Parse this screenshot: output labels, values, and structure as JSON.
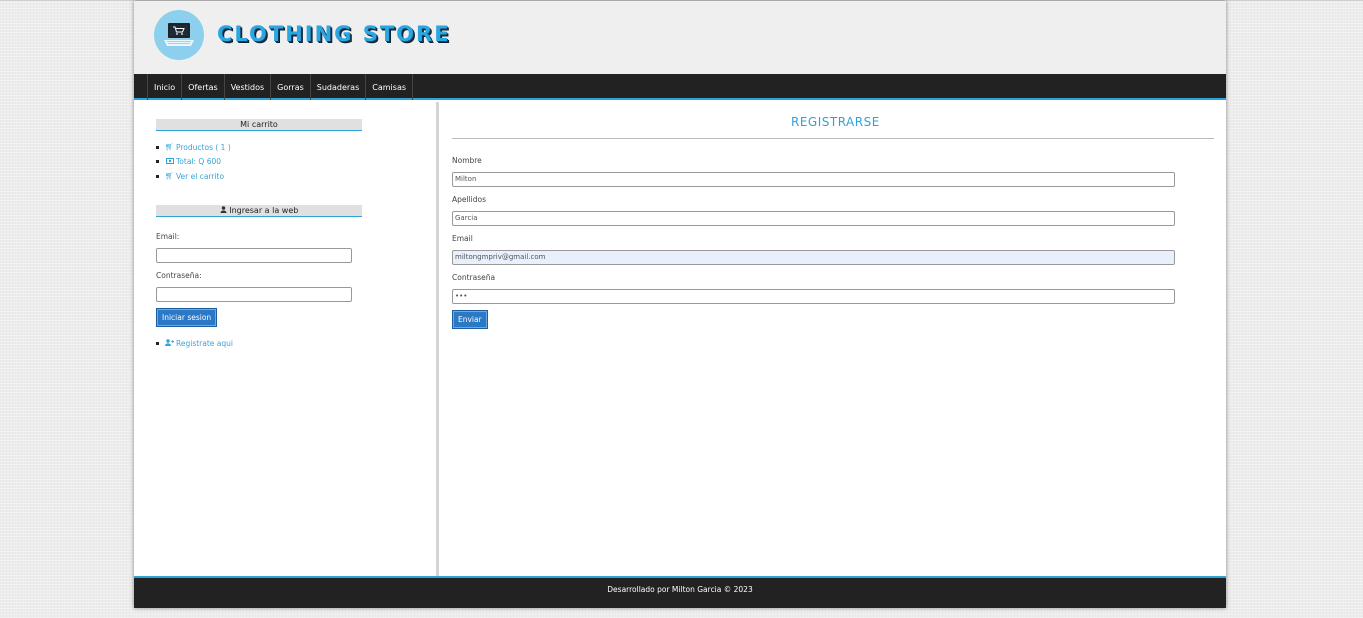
{
  "header": {
    "title": "CLOTHING STORE",
    "logo_icon": "laptop-cart-icon"
  },
  "nav": {
    "items": [
      "Inicio",
      "Ofertas",
      "Vestidos",
      "Gorras",
      "Sudaderas",
      "Camisas"
    ]
  },
  "cart": {
    "title": "Mi carrito",
    "items": [
      {
        "icon": "cart-icon",
        "label": "Productos ( 1 )"
      },
      {
        "icon": "money-icon",
        "label": "Total: Q 600"
      },
      {
        "icon": "cart-icon",
        "label": "Ver el carrito"
      }
    ]
  },
  "login": {
    "title": "Ingresar a la web",
    "title_icon": "user-icon",
    "email_label": "Email:",
    "password_label": "Contraseña:",
    "submit_label": "Iniciar sesion",
    "register_link": "Registrate aqui",
    "register_icon": "user-plus-icon"
  },
  "register": {
    "title": "REGISTRARSE",
    "fields": [
      {
        "label": "Nombre",
        "value": "Milton"
      },
      {
        "label": "Apellidos",
        "value": "Garcia"
      },
      {
        "label": "Email",
        "value": "miltongmpriv@gmail.com"
      },
      {
        "label": "Contraseña",
        "value": "•••"
      }
    ],
    "submit_label": "Enviar"
  },
  "footer": {
    "text": "Desarrollado por Milton Garcia © 2023"
  },
  "colors": {
    "accent": "#2ea3d8",
    "nav_bg": "#222222",
    "button": "#2a78c6"
  }
}
